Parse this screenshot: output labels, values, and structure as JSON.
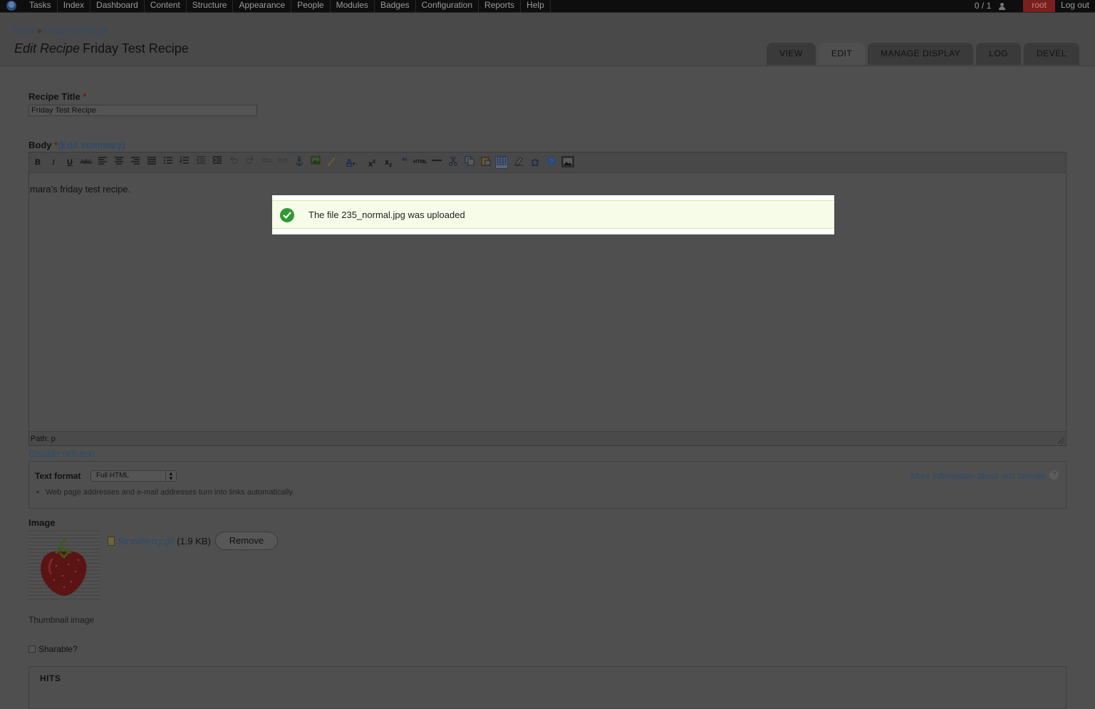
{
  "toolbar": {
    "menu": [
      "Tasks",
      "Index",
      "Dashboard",
      "Content",
      "Structure",
      "Appearance",
      "People",
      "Modules",
      "Badges",
      "Configuration",
      "Reports",
      "Help"
    ],
    "users_online": "0 / 1",
    "user": "root",
    "logout": "Log out"
  },
  "breadcrumb": {
    "home": "Home",
    "separator": "»",
    "current": "Friday Test Recipe"
  },
  "title": {
    "prefix": "Edit Recipe",
    "name": "Friday Test Recipe"
  },
  "tabs": [
    "VIEW",
    "EDIT",
    "MANAGE DISPLAY",
    "LOG",
    "DEVEL"
  ],
  "active_tab": "EDIT",
  "form": {
    "recipe_title_label": "Recipe Title",
    "required_marker": "*",
    "recipe_title_value": "Friday Test Recipe",
    "body_label": "Body",
    "edit_summary": "(Edit summary)",
    "body_content": "mara's friday test recipe.",
    "editor_path": "Path: p",
    "disable_rich_text": "Disable rich-text",
    "text_format_label": "Text format",
    "text_format_value": "Full HTML",
    "text_format_tip": "Web page addresses and e-mail addresses turn into links automatically.",
    "more_info": "More information about text formats",
    "image_label": "Image",
    "file_name": "Strawberry.gif",
    "file_size": "(1.9 KB)",
    "remove_button": "Remove",
    "thumbnail_description": "Thumbnail image",
    "sharable_label": "Sharable?",
    "hits_label": "HITS"
  },
  "editor_toolbar_icons": [
    "bold",
    "italic",
    "underline",
    "strikethrough",
    "align-left",
    "align-center",
    "align-right",
    "justify",
    "bullet-list",
    "numbered-list",
    "outdent",
    "indent",
    "undo",
    "redo",
    "link",
    "unlink",
    "anchor",
    "image",
    "cleanup",
    "text-color",
    "superscript",
    "subscript",
    "blockquote",
    "html-source",
    "horizontal-rule",
    "cut",
    "copy",
    "paste-text",
    "table",
    "remove-format",
    "special-char",
    "help",
    "insert-image"
  ],
  "message": {
    "text": "The file 235_normal.jpg was uploaded",
    "status_color": "#2f9a32"
  }
}
